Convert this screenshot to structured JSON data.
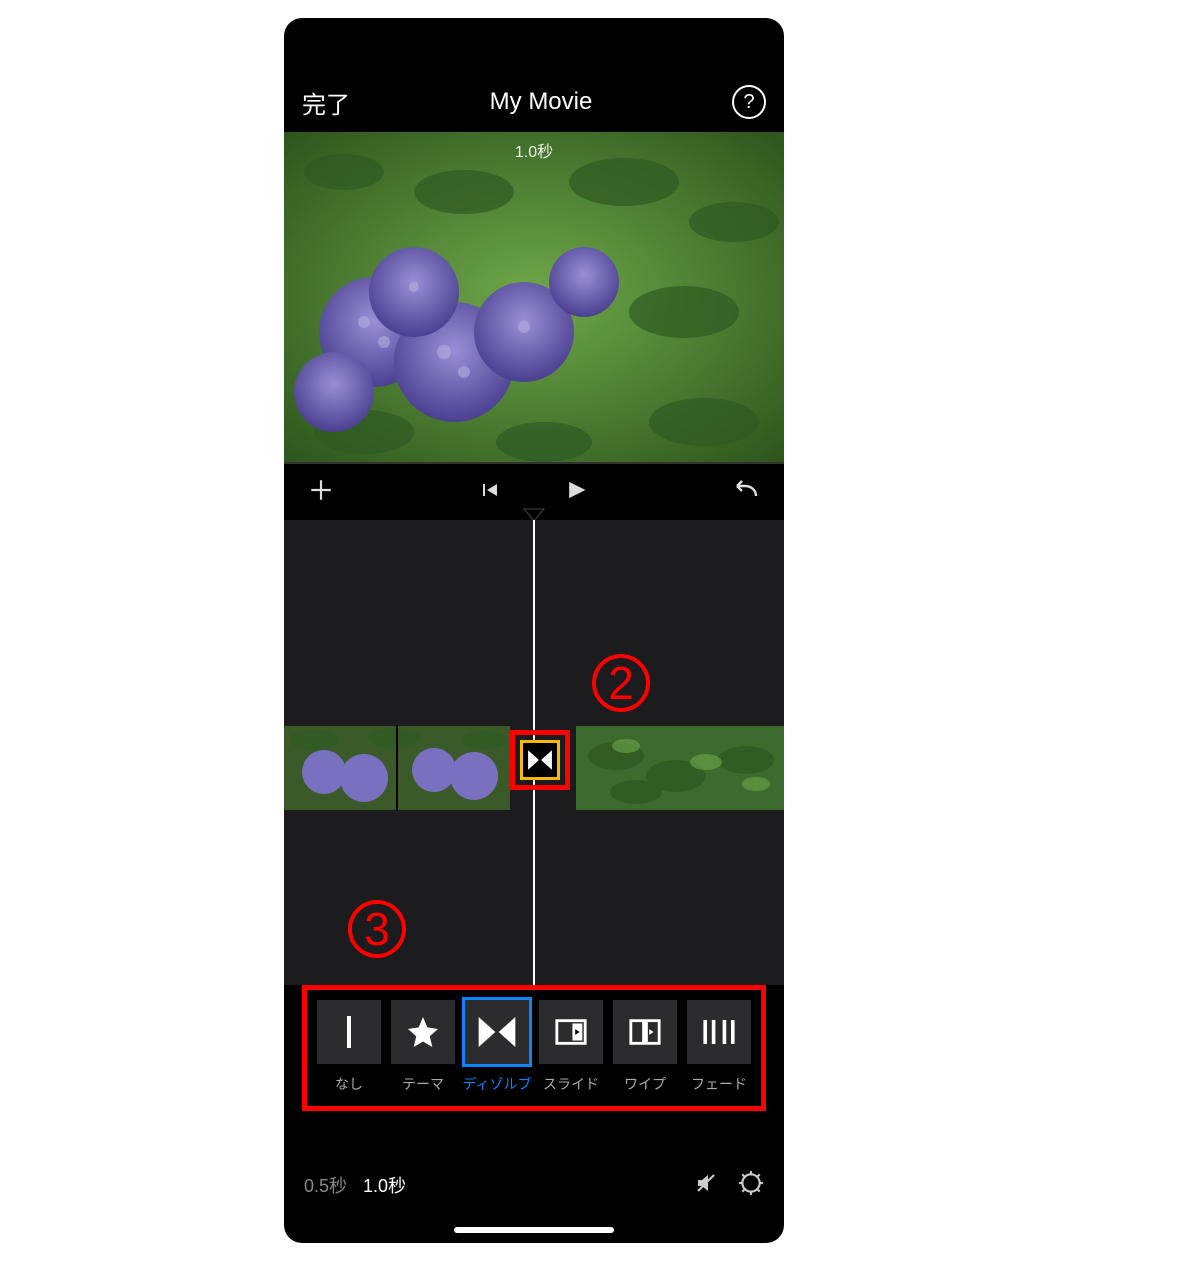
{
  "nav": {
    "done": "完了",
    "title": "My Movie",
    "help": "?"
  },
  "preview": {
    "duration": "1.0秒"
  },
  "transport": {
    "add": "add-icon",
    "prev": "previous-icon",
    "play": "play-icon",
    "undo": "undo-icon"
  },
  "annotations": {
    "two": "2",
    "three": "3"
  },
  "transitions": {
    "items": [
      {
        "id": "none",
        "label": "なし",
        "selected": false
      },
      {
        "id": "theme",
        "label": "テーマ",
        "selected": false
      },
      {
        "id": "dissolve",
        "label": "ディゾルブ",
        "selected": true
      },
      {
        "id": "slide",
        "label": "スライド",
        "selected": false
      },
      {
        "id": "wipe",
        "label": "ワイプ",
        "selected": false
      },
      {
        "id": "fade",
        "label": "フェード",
        "selected": false
      }
    ]
  },
  "durations": {
    "opt1": "0.5秒",
    "opt2": "1.0秒",
    "active": "1.0秒"
  },
  "footer": {
    "mute": "mute-icon",
    "gear": "settings-icon"
  }
}
